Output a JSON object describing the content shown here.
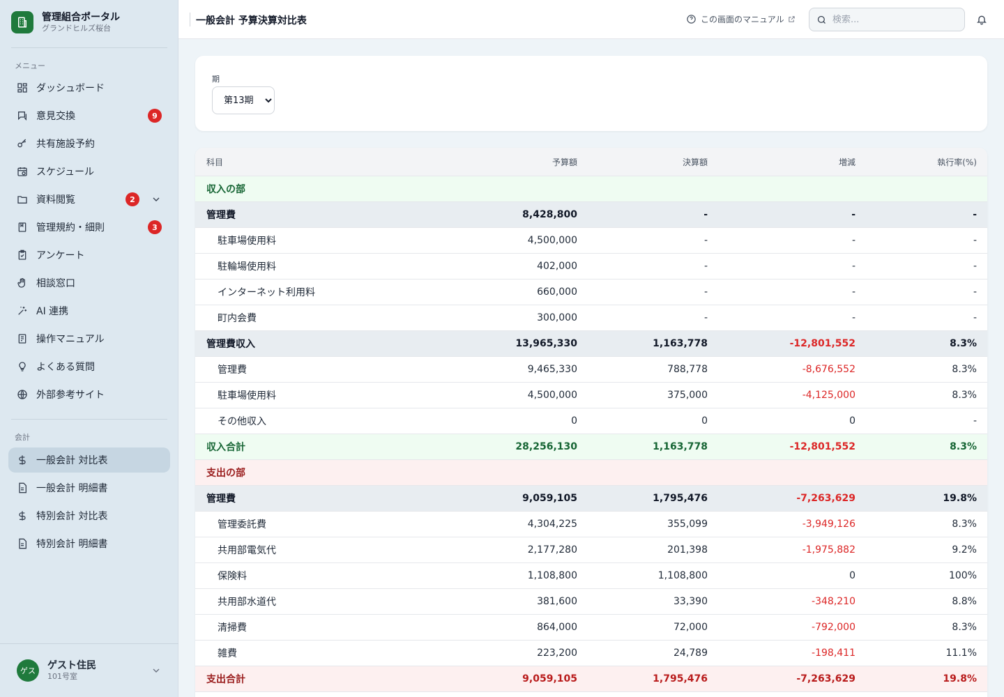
{
  "brand": {
    "title": "管理組合ポータル",
    "subtitle": "グランドヒルズ桜台"
  },
  "sidebar": {
    "menu_label": "メニュー",
    "accounting_label": "会計",
    "items": [
      {
        "label": "ダッシュボード",
        "icon": "dashboard-icon"
      },
      {
        "label": "意見交換",
        "icon": "chat-icon",
        "badge": "9"
      },
      {
        "label": "共有施設予約",
        "icon": "key-icon"
      },
      {
        "label": "スケジュール",
        "icon": "calendar-icon"
      },
      {
        "label": "資料閲覧",
        "icon": "folder-icon",
        "badge": "2"
      },
      {
        "label": "管理規約・細則",
        "icon": "book-icon",
        "badge": "3"
      },
      {
        "label": "アンケート",
        "icon": "clipboard-icon"
      },
      {
        "label": "相談窓口",
        "icon": "hand-icon"
      },
      {
        "label": "AI 連携",
        "icon": "sparkle-icon"
      },
      {
        "label": "操作マニュアル",
        "icon": "manual-icon"
      },
      {
        "label": "よくある質問",
        "icon": "lightbulb-icon"
      },
      {
        "label": "外部参考サイト",
        "icon": "globe-icon"
      }
    ],
    "accounting_items": [
      {
        "label": "一般会計 対比表",
        "icon": "dollar-icon",
        "active": true
      },
      {
        "label": "一般会計 明細書",
        "icon": "document-icon"
      },
      {
        "label": "特別会計 対比表",
        "icon": "dollar-icon"
      },
      {
        "label": "特別会計 明細書",
        "icon": "document-icon"
      }
    ]
  },
  "user": {
    "avatar": "ゲス",
    "name": "ゲスト住民",
    "room": "101号室"
  },
  "header": {
    "title": "一般会計 予算決算対比表",
    "manual_link": "この画面のマニュアル",
    "search_placeholder": "検索..."
  },
  "filter": {
    "label": "期",
    "selected": "第13期"
  },
  "table": {
    "headers": {
      "subject": "科目",
      "budget": "予算額",
      "actual": "決算額",
      "diff": "増減",
      "rate": "執行率(%)"
    },
    "rows": [
      {
        "type": "section-in",
        "subject": "収入の部",
        "budget": "",
        "actual": "",
        "diff": "",
        "rate": ""
      },
      {
        "type": "group",
        "subject": "管理費",
        "budget": "8,428,800",
        "actual": "-",
        "diff": "-",
        "rate": "-"
      },
      {
        "type": "item",
        "subject": "駐車場使用料",
        "budget": "4,500,000",
        "actual": "-",
        "diff": "-",
        "rate": "-"
      },
      {
        "type": "item",
        "subject": "駐輪場使用料",
        "budget": "402,000",
        "actual": "-",
        "diff": "-",
        "rate": "-"
      },
      {
        "type": "item",
        "subject": "インターネット利用料",
        "budget": "660,000",
        "actual": "-",
        "diff": "-",
        "rate": "-"
      },
      {
        "type": "item",
        "subject": "町内会費",
        "budget": "300,000",
        "actual": "-",
        "diff": "-",
        "rate": "-"
      },
      {
        "type": "group",
        "subject": "管理費収入",
        "budget": "13,965,330",
        "actual": "1,163,778",
        "diff": "-12,801,552",
        "rate": "8.3%",
        "neg": true
      },
      {
        "type": "item",
        "subject": "管理費",
        "budget": "9,465,330",
        "actual": "788,778",
        "diff": "-8,676,552",
        "rate": "8.3%",
        "neg": true
      },
      {
        "type": "item",
        "subject": "駐車場使用料",
        "budget": "4,500,000",
        "actual": "375,000",
        "diff": "-4,125,000",
        "rate": "8.3%",
        "neg": true
      },
      {
        "type": "item",
        "subject": "その他収入",
        "budget": "0",
        "actual": "0",
        "diff": "0",
        "rate": "-"
      },
      {
        "type": "total-in",
        "subject": "収入合計",
        "budget": "28,256,130",
        "actual": "1,163,778",
        "diff": "-12,801,552",
        "rate": "8.3%",
        "neg": true
      },
      {
        "type": "section-out",
        "subject": "支出の部",
        "budget": "",
        "actual": "",
        "diff": "",
        "rate": ""
      },
      {
        "type": "group",
        "subject": "管理費",
        "budget": "9,059,105",
        "actual": "1,795,476",
        "diff": "-7,263,629",
        "rate": "19.8%",
        "neg": true
      },
      {
        "type": "item",
        "subject": "管理委託費",
        "budget": "4,304,225",
        "actual": "355,099",
        "diff": "-3,949,126",
        "rate": "8.3%",
        "neg": true
      },
      {
        "type": "item",
        "subject": "共用部電気代",
        "budget": "2,177,280",
        "actual": "201,398",
        "diff": "-1,975,882",
        "rate": "9.2%",
        "neg": true
      },
      {
        "type": "item",
        "subject": "保険料",
        "budget": "1,108,800",
        "actual": "1,108,800",
        "diff": "0",
        "rate": "100%"
      },
      {
        "type": "item",
        "subject": "共用部水道代",
        "budget": "381,600",
        "actual": "33,390",
        "diff": "-348,210",
        "rate": "8.8%",
        "neg": true
      },
      {
        "type": "item",
        "subject": "清掃費",
        "budget": "864,000",
        "actual": "72,000",
        "diff": "-792,000",
        "rate": "8.3%",
        "neg": true
      },
      {
        "type": "item",
        "subject": "雑費",
        "budget": "223,200",
        "actual": "24,789",
        "diff": "-198,411",
        "rate": "11.1%",
        "neg": true
      },
      {
        "type": "total-out",
        "subject": "支出合計",
        "budget": "9,059,105",
        "actual": "1,795,476",
        "diff": "-7,263,629",
        "rate": "19.8%",
        "neg": true
      }
    ]
  },
  "colors": {
    "brand_green": "#1f7a3c",
    "badge_red": "#dc2626",
    "income_green": "#166534",
    "expense_red": "#991b1b"
  }
}
